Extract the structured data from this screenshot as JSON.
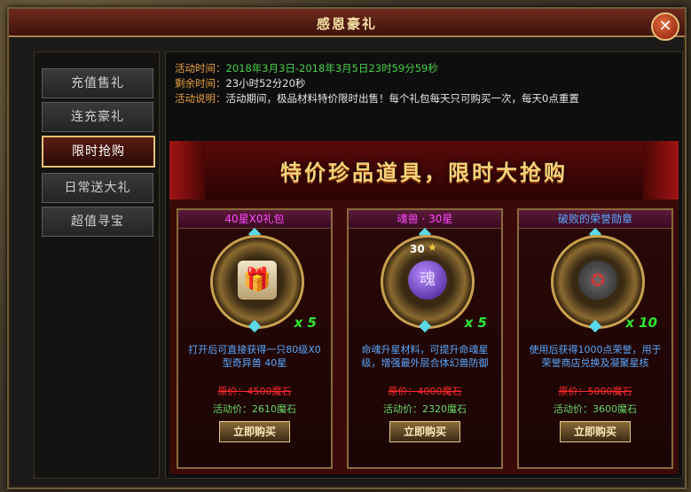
{
  "window": {
    "title": "感恩豪礼"
  },
  "sidebar": {
    "items": [
      {
        "label": "充值售礼"
      },
      {
        "label": "连充豪礼"
      },
      {
        "label": "限时抢购"
      },
      {
        "label": "日常送大礼"
      },
      {
        "label": "超值寻宝"
      }
    ]
  },
  "info": {
    "time_label": "活动时间：",
    "time_value": "2018年3月3日-2018年3月5日23时59分59秒",
    "remain_label": "剩余时间：",
    "remain_value": "23小时52分20秒",
    "desc_label": "活动说明：",
    "desc_value": "活动期间，极品材料特价限时出售！每个礼包每天只可购买一次，每天0点重置"
  },
  "banner": {
    "title": "特价珍品道具，限时大抢购"
  },
  "cards": [
    {
      "name": "40星X0礼包",
      "name_color": "#ff4aff",
      "icon": "gift-box-icon",
      "level": "",
      "qty": "x 5",
      "desc": "打开后可直接获得一只80级X0型奇异兽 40星",
      "orig": "原价：4500魔石",
      "act": "活动价：2610魔石",
      "buy": "立即购买"
    },
    {
      "name": "魂兽 · 30星",
      "name_color": "#ff4aff",
      "icon": "soul-egg-icon",
      "level": "30",
      "qty": "x 5",
      "desc": "命魂升星材料，可提升命魂星级，增强最外层合体幻兽防御",
      "orig": "原价：4000魔石",
      "act": "活动价：2320魔石",
      "buy": "立即购买"
    },
    {
      "name": "破败的荣誉勋章",
      "name_color": "#5aa8ff",
      "icon": "honor-medal-icon",
      "level": "",
      "qty": "x 10",
      "desc": "使用后获得1000点荣誉，用于荣誉商店兑换及凝聚星核",
      "orig": "原价：5000魔石",
      "act": "活动价：3600魔石",
      "buy": "立即购买"
    }
  ]
}
